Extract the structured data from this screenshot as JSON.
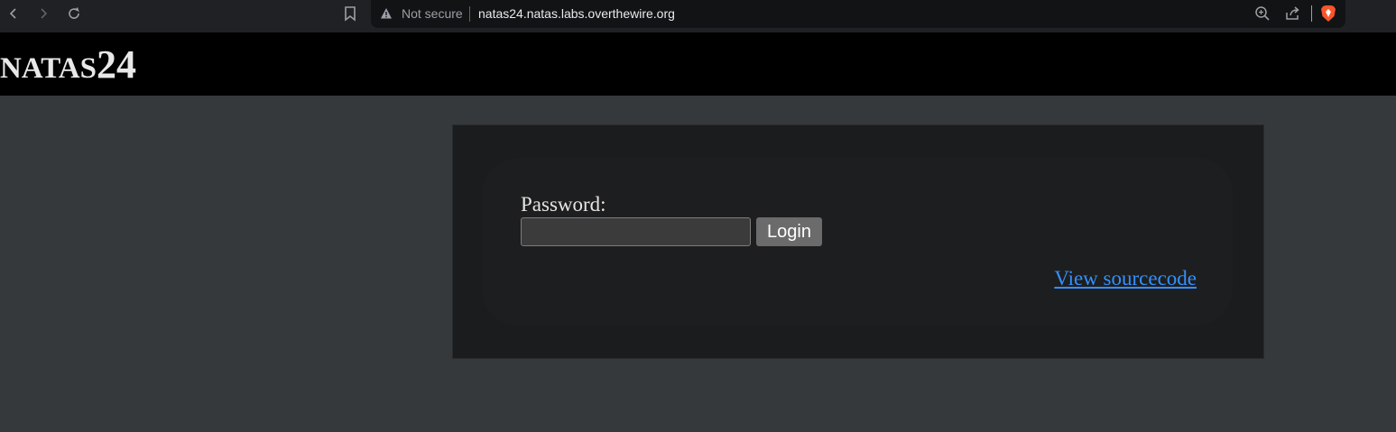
{
  "browser": {
    "security_label": "Not secure",
    "url": "natas24.natas.labs.overthewire.org",
    "icons": [
      "back-icon",
      "forward-icon",
      "reload-icon",
      "bookmark-icon",
      "warning-icon",
      "zoom-icon",
      "share-icon",
      "brave-shield-icon"
    ]
  },
  "header": {
    "title_prefix": "NATAS",
    "title_number": "24"
  },
  "form": {
    "password_label": "Password:",
    "password_value": "",
    "login_label": "Login"
  },
  "links": {
    "view_source": "View sourcecode"
  },
  "colors": {
    "page_bg": "#35393c",
    "header_bg": "#000000",
    "link": "#3391ff",
    "button": "#6b6b6b"
  }
}
